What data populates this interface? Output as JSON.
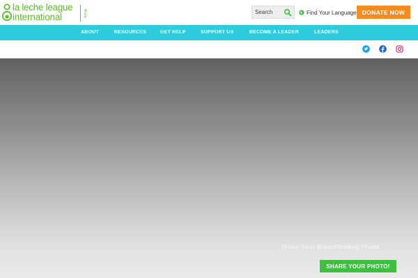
{
  "colors": {
    "brand_green": "#5cbf2a",
    "nav_teal": "#2ecbdc",
    "donate_orange": "#f68b1f",
    "cta_green": "#3fbf3f",
    "twitter_blue": "#1da1f2",
    "facebook_blue": "#1e66c8",
    "instagram_pink": "#d6336c"
  },
  "header": {
    "logo_line_1": "la leche league",
    "logo_line_2": "international",
    "logo_side": "llli.org",
    "search": {
      "placeholder": "Search",
      "icon": "search-icon"
    },
    "language": {
      "label": "Find Your Language",
      "icon": "globe-icon"
    },
    "donate_label": "DONATE NOW"
  },
  "nav": {
    "items": [
      {
        "label": "ABOUT"
      },
      {
        "label": "RESOURCES"
      },
      {
        "label": "GET HELP"
      },
      {
        "label": "SUPPORT US"
      },
      {
        "label": "BECOME A LEADER"
      },
      {
        "label": "LEADERS"
      }
    ]
  },
  "social": {
    "icons": [
      "twitter-icon",
      "facebook-icon",
      "instagram-icon"
    ]
  },
  "hero": {
    "title": "Share Your Breastfeeding Photo",
    "button_label": "SHARE YOUR PHOTO!"
  }
}
